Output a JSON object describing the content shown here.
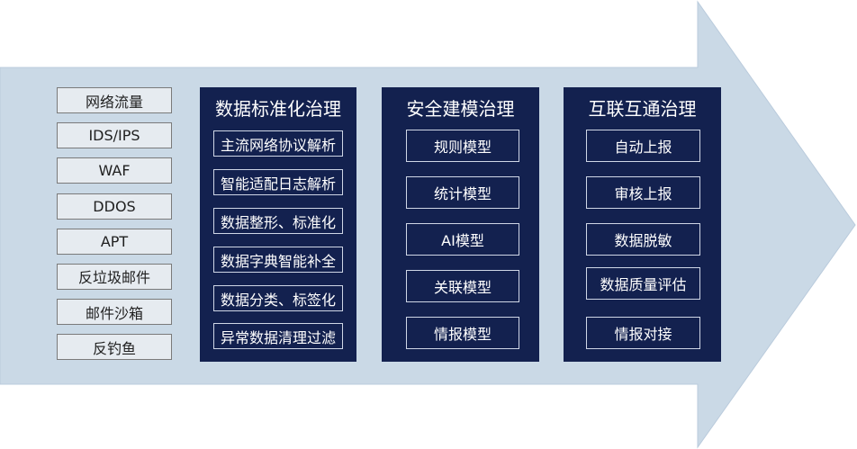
{
  "colors": {
    "arrow_fill": "#cad9e6",
    "arrow_stroke": "#bacbdc",
    "panel_bg": "#13214f",
    "panel_item_border": "#cfd6e6",
    "source_border": "#7a7a7a",
    "source_bg": "#e6ebf0"
  },
  "sources": [
    "网络流量",
    "IDS/IPS",
    "WAF",
    "DDOS",
    "APT",
    "反垃圾邮件",
    "邮件沙箱",
    "反钓鱼"
  ],
  "panels": [
    {
      "title": "数据标准化治理",
      "items": [
        "主流网络协议解析",
        "智能适配日志解析",
        "数据整形、标准化",
        "数据字典智能补全",
        "数据分类、标签化",
        "异常数据清理过滤"
      ]
    },
    {
      "title": "安全建模治理",
      "items": [
        "规则模型",
        "统计模型",
        "AI模型",
        "关联模型",
        "情报模型"
      ]
    },
    {
      "title": "互联互通治理",
      "items": [
        "自动上报",
        "审核上报",
        "数据脱敏",
        "数据质量评估",
        "情报对接"
      ]
    }
  ]
}
